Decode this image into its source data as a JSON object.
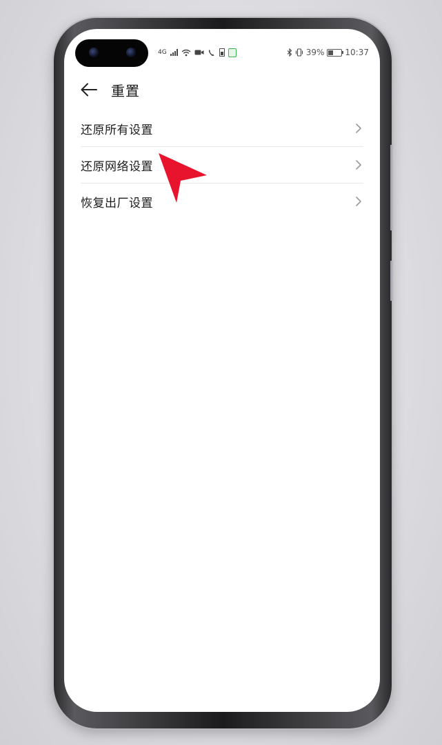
{
  "status_bar": {
    "network_label": "4G",
    "battery_percent": "39%",
    "time": "10:37",
    "icons": [
      "signal-icon",
      "wifi-icon",
      "video-call-icon",
      "call-icon",
      "battery-small-icon",
      "app-notification-icon",
      "bluetooth-icon",
      "vibrate-icon",
      "battery-icon"
    ]
  },
  "header": {
    "back_icon": "back-arrow-icon",
    "title": "重置"
  },
  "menu": {
    "items": [
      {
        "label": "还原所有设置",
        "icon": "chevron-right-icon"
      },
      {
        "label": "还原网络设置",
        "icon": "chevron-right-icon"
      },
      {
        "label": "恢复出厂设置",
        "icon": "chevron-right-icon"
      }
    ]
  },
  "colors": {
    "accent_pointer": "#e8142e",
    "text_primary": "#1c1c1c",
    "divider": "#e8e8e8",
    "notification_green": "#36b24a"
  }
}
